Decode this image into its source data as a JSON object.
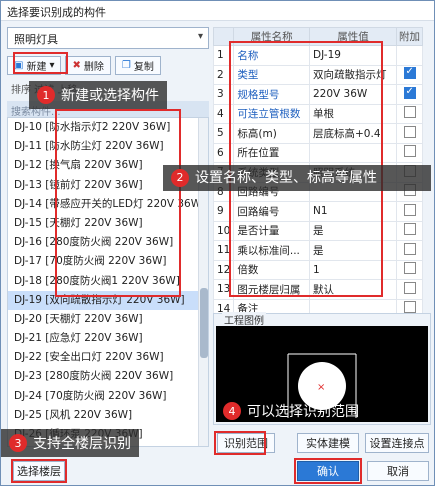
{
  "window": {
    "title": "选择要识别成的构件"
  },
  "left": {
    "category_select": "照明灯具",
    "toolbar": {
      "new_label": "新建",
      "delete_label": "删除",
      "copy_label": "复制"
    },
    "filter_row": "排序  过滤  上移",
    "search_placeholder": "搜索构件...",
    "items": [
      "DJ-10 [防水指示灯2 220V 36W]",
      "DJ-11 [防水防尘灯 220V 36W]",
      "DJ-12 [换气扇 220V 36W]",
      "DJ-13 [镜前灯 220V 36W]",
      "DJ-14 [带感应开关的LED灯 220V 36W]",
      "DJ-15 [天棚灯 220V 36W]",
      "DJ-16 [280度防火阀 220V 36W]",
      "DJ-17 [70度防火阀 220V 36W]",
      "DJ-18 [280度防火阀1 220V 36W]",
      "DJ-19 [双向疏散指示灯 220V 36W]",
      "DJ-20 [天棚灯 220V 36W]",
      "DJ-21 [应急灯 220V 36W]",
      "DJ-22 [安全出口灯 220V 36W]",
      "DJ-23 [280度防火阀 220V 36W]",
      "DJ-24 [70度防火阀 220V 36W]",
      "DJ-25 [风机 220V 36W]",
      "DJ-26 [循环泵 220V 36W]",
      "DJ-27 [280度防火阀 220V 36W]",
      "DJ-28 [荧光灯 220V 36W]"
    ]
  },
  "properties": {
    "headers": [
      "属性名称",
      "属性值",
      "附加"
    ],
    "rows": [
      {
        "n": "1",
        "name": "名称",
        "value": "DJ-19",
        "blue": true,
        "cb": "none"
      },
      {
        "n": "2",
        "name": "类型",
        "value": "双向疏散指示灯",
        "blue": true,
        "cb": "on"
      },
      {
        "n": "3",
        "name": "规格型号",
        "value": "220V 36W",
        "blue": true,
        "cb": "on"
      },
      {
        "n": "4",
        "name": "可连立管根数",
        "value": "单根",
        "blue": true,
        "cb": "off"
      },
      {
        "n": "5",
        "name": "标高(m)",
        "value": "层底标高+0.4",
        "blue": false,
        "cb": "off"
      },
      {
        "n": "6",
        "name": "所在位置",
        "value": "",
        "blue": false,
        "cb": "off"
      },
      {
        "n": "7",
        "name": "系统类型",
        "value": "照明系统",
        "blue": false,
        "cb": "off"
      },
      {
        "n": "8",
        "name": "回路编号",
        "value": "",
        "blue": false,
        "cb": "off"
      },
      {
        "n": "9",
        "name": "回路编号",
        "value": "N1",
        "blue": false,
        "cb": "off"
      },
      {
        "n": "10",
        "name": "是否计量",
        "value": "是",
        "blue": false,
        "cb": "off"
      },
      {
        "n": "11",
        "name": "乘以标准间...",
        "value": "是",
        "blue": false,
        "cb": "off"
      },
      {
        "n": "12",
        "name": "倍数",
        "value": "1",
        "blue": false,
        "cb": "off"
      },
      {
        "n": "13",
        "name": "图元楼层归属",
        "value": "默认",
        "blue": false,
        "cb": "off"
      },
      {
        "n": "14",
        "name": "备注",
        "value": "",
        "blue": false,
        "cb": "off"
      },
      {
        "n": "15",
        "name": "+ 显示样式",
        "value": "",
        "blue": false,
        "cb": "none"
      }
    ]
  },
  "legend": {
    "title": "工程图例"
  },
  "buttons": {
    "identify_range": "识别范围",
    "entity_model": "实体建模",
    "set_connection": "设置连接点",
    "select_floor": "选择楼层",
    "confirm": "确认",
    "cancel": "取消"
  },
  "callouts": {
    "c1": {
      "num": "1",
      "text": "新建或选择构件"
    },
    "c2": {
      "num": "2",
      "text": "设置名称、类型、标高等属性"
    },
    "c3": {
      "num": "3",
      "text": "支持全楼层识别"
    },
    "c4": {
      "num": "4",
      "text": "可以选择识别范围"
    }
  },
  "colors": {
    "highlight": "#e02b2b",
    "accent": "#2b79d6"
  }
}
